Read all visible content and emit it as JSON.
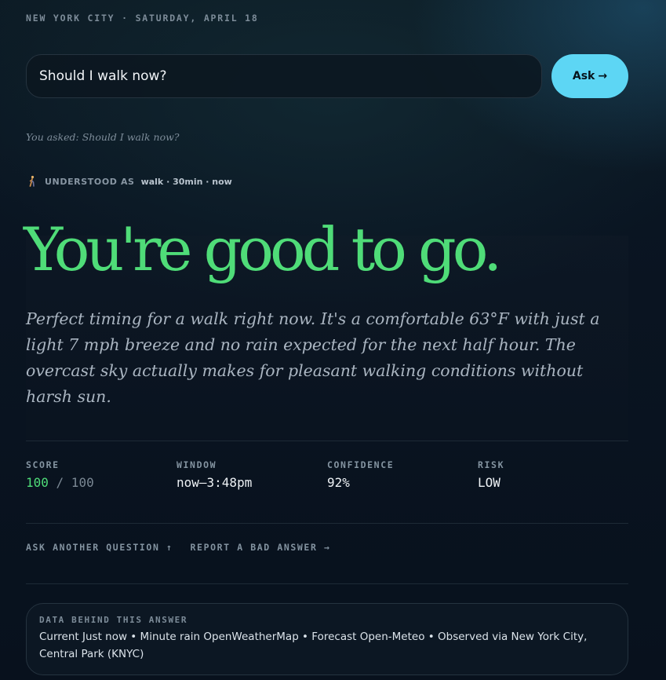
{
  "header": {
    "location_date": "NEW YORK CITY · SATURDAY, APRIL 18"
  },
  "search": {
    "value": "Should I walk now?",
    "placeholder": "",
    "ask_label": "Ask",
    "ask_arrow": "→"
  },
  "query_echo": "You asked: Should I walk now?",
  "understood": {
    "icon": "walking-person-icon",
    "label": "UNDERSTOOD AS",
    "value": "walk · 30min · now"
  },
  "verdict": {
    "headline": "You're good to go.",
    "summary": "Perfect timing for a walk right now. It's a comfortable 63°F with just a light 7 mph breeze and no rain expected for the next half hour. The overcast sky actually makes for pleasant walking conditions without harsh sun."
  },
  "stats": {
    "score": {
      "label": "SCORE",
      "value": "100",
      "total": " / 100"
    },
    "window": {
      "label": "WINDOW",
      "value": "now–3:48pm"
    },
    "confidence": {
      "label": "CONFIDENCE",
      "value": "92%"
    },
    "risk": {
      "label": "RISK",
      "value": "LOW"
    }
  },
  "actions": {
    "ask_another": "ASK ANOTHER QUESTION ↑",
    "report_bad": "REPORT A BAD ANSWER →"
  },
  "data_card": {
    "label": "DATA BEHIND THIS ANSWER",
    "text": "Current Just now • Minute rain OpenWeatherMap • Forecast Open-Meteo • Observed via New York City, Central Park (KNYC)"
  },
  "colors": {
    "accent": "#5dd6f4",
    "good": "#4fdc78",
    "background": "#0a1522"
  }
}
